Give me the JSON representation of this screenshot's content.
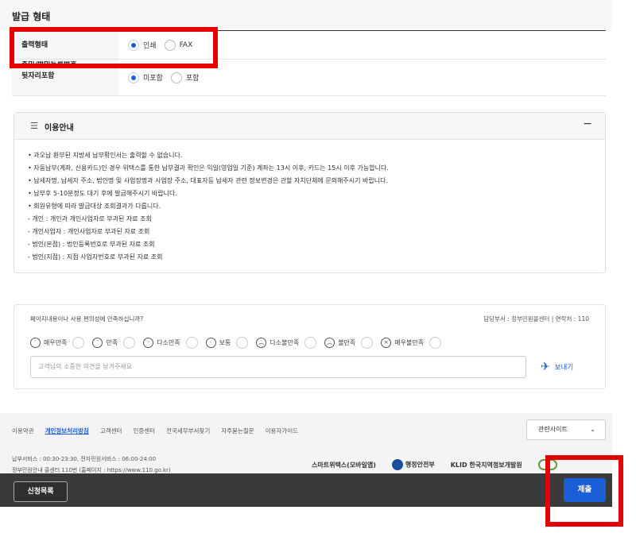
{
  "section": {
    "title": "발급 형태"
  },
  "form": {
    "rows": [
      {
        "label": "출력형태",
        "options": [
          "인쇄",
          "FAX"
        ],
        "selected": "인쇄"
      },
      {
        "label_top": "주민/법인등록번호",
        "label_bottom": "뒷자리포함",
        "options": [
          "미포함",
          "포함"
        ],
        "selected": "미포함"
      }
    ]
  },
  "info": {
    "title": "이용안내",
    "toggle": "−",
    "items": [
      "• 과오납 환부된 지방세 납부확인서는 출력할 수 없습니다.",
      "• 자동납부(계좌, 신용카드)인 경우 위택스를 통한 납부결과 확인은 익일(영업일 기준) 계좌는 13시 이후, 카드는 15시 이후 가능합니다.",
      "• 납세자명, 납세자 주소, 법인명 및 사업장명과 사업장 주소, 대표자등 납세자 관련 정보변경은 관할 자치단체에 문의해주시기 바랍니다.",
      "• 납부후 5-10분정도 대기 후에 발급해주시기 바랍니다.",
      "• 회원유형에 따라 발급대상 조회결과가 다릅니다.",
      "  - 개인 : 개인과 개인사업자로 부과된 자료 조회",
      "  - 개인사업자 : 개인사업자로 부과된 자료 조회",
      "  - 법인(본점) : 법인등록번호로 부과된 자료 조회",
      "  - 법인(지점) : 지점 사업자번호로 부과된 자료 조회"
    ]
  },
  "survey": {
    "question": "페이지내용이나 사용 편의성에 만족하십니까?",
    "dept": "담당부서 : 정부민원콜센터  |  연락처 : 110",
    "ratings": [
      "매우만족",
      "만족",
      "다소만족",
      "보통",
      "다소불만족",
      "불만족",
      "매우불만족"
    ],
    "comment_placeholder": "고객님의 소중한 의견을 남겨주세요",
    "send_label": "보내기"
  },
  "footer": {
    "links": [
      "이용약관",
      "개인정보처리방침",
      "고객센터",
      "인증센터",
      "전국세무부서찾기",
      "자주묻는질문",
      "이용자가이드"
    ],
    "related_sites": "관련사이트",
    "hours_line1": "납부서비스 : 00:30-23:30, 전자민원서비스 : 06:00-24:00",
    "hours_line2": "정부민원안내 콜센터 110번 (홈페이지 : https://www.110.go.kr)",
    "logos": [
      "스마트위택스(모바일앱)",
      "행정안전부",
      "KLID 한국지역정보개발원"
    ]
  },
  "bottom": {
    "apply_list": "신청목록",
    "submit": "제출"
  },
  "colors": {
    "accent": "#1a5fd8",
    "highlight": "#e60000",
    "bar": "#3a3a3a"
  }
}
